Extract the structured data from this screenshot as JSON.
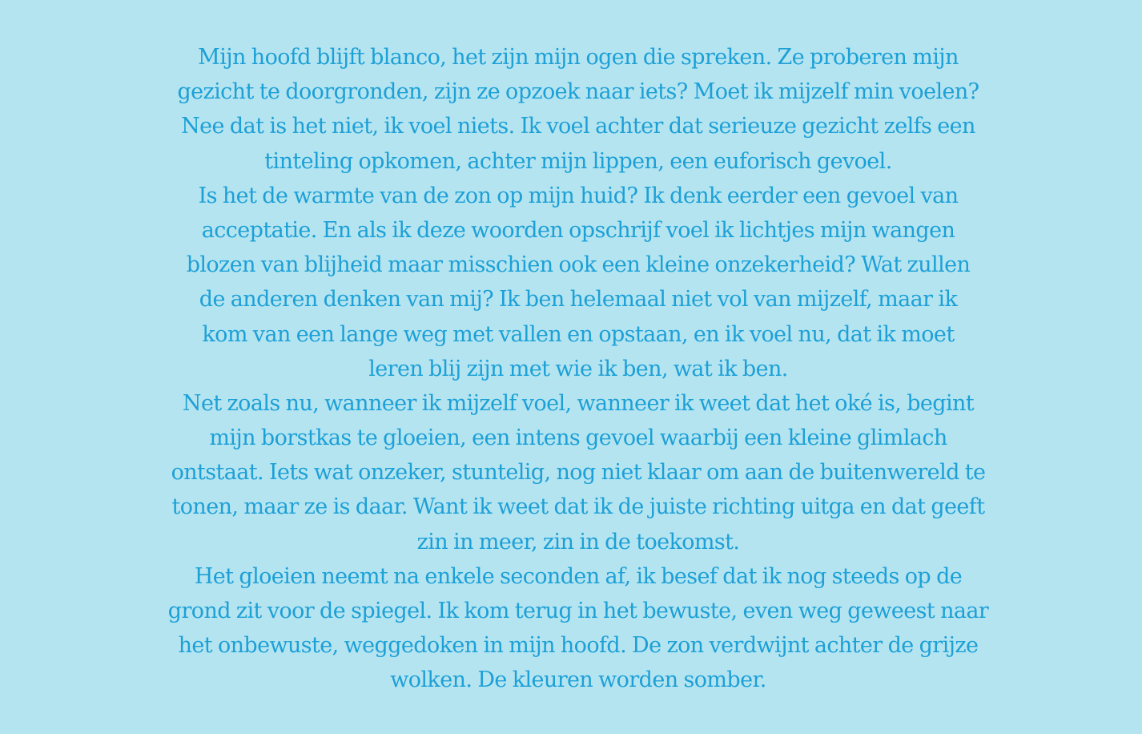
{
  "colors": {
    "background": "#b5e4f1",
    "text": "#1ca0d6"
  },
  "lines": [
    "Mijn hoofd blijft blanco, het zijn mijn ogen die spreken. Ze proberen mijn",
    "gezicht te doorgronden, zijn ze opzoek naar iets? Moet ik mijzelf min voelen?",
    "Nee dat is het niet, ik voel niets. Ik voel achter dat serieuze gezicht zelfs een",
    "tinteling opkomen, achter mijn lippen, een euforisch gevoel.",
    "Is het de warmte van de zon op mijn huid? Ik denk eerder een gevoel van",
    "acceptatie. En als ik deze woorden opschrijf voel ik lichtjes mijn wangen",
    "blozen van blijheid maar misschien ook een kleine onzekerheid? Wat zullen",
    "de anderen denken van mij? Ik ben helemaal niet vol van mijzelf, maar ik",
    "kom van een lange weg met vallen en opstaan, en ik voel nu, dat ik moet",
    "leren blij zijn met wie ik ben, wat ik ben.",
    "Net zoals nu, wanneer ik mijzelf voel, wanneer ik weet dat het oké is, begint",
    "mijn borstkas te gloeien, een intens gevoel waarbij een kleine glimlach",
    "ontstaat. Iets wat onzeker, stuntelig, nog niet klaar om aan de buitenwereld te",
    "tonen, maar ze is daar. Want ik weet dat ik de juiste richting uitga en dat geeft",
    "zin in meer, zin in de toekomst.",
    "Het gloeien neemt na enkele seconden af, ik besef dat ik nog steeds op de",
    "grond zit voor de spiegel. Ik kom terug in het bewuste, even weg geweest naar",
    "het onbewuste, weggedoken in mijn hoofd. De zon verdwijnt achter de grijze",
    "wolken. De kleuren worden somber."
  ]
}
